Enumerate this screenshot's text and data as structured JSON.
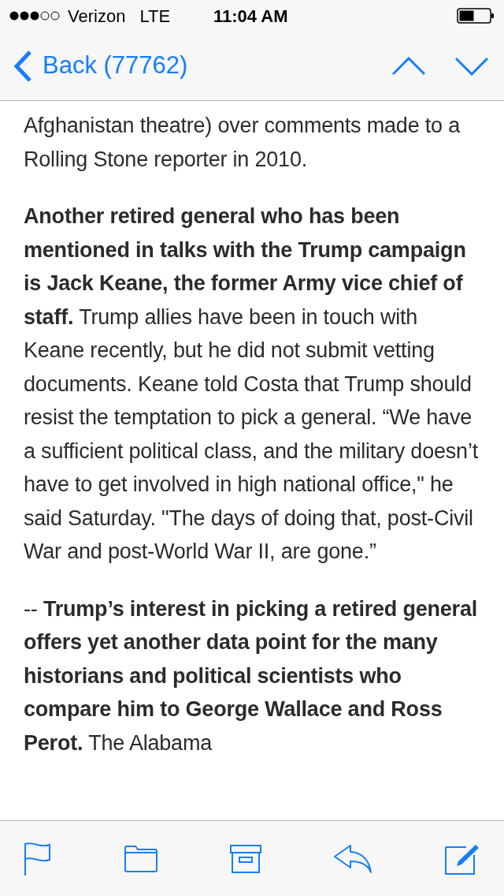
{
  "status_bar": {
    "carrier": "Verizon",
    "network": "LTE",
    "time": "11:04 AM"
  },
  "nav_bar": {
    "back": "Back (77762)"
  },
  "message": {
    "paragraphs": [
      "Afghanistan theatre) over comments made to a Rolling Stone reporter in 2010.",
      "**Another retired general who has been mentioned in talks with the Trump campaign is Jack Keane, the former Army vice chief of staff.** Trump allies have been in touch with Keane recently, but he did not submit vetting documents. Keane told Costa that Trump should resist the temptation to pick a general. “We have a sufficient political class, and the military doesn’t have to get involved in high national office,\" he said Saturday. \"The days of doing that, post-Civil War and post-World War II, are gone.”",
      "-- **Trump’s interest in picking a retired general offers yet another data point for the many historians and political scientists who compare him to George Wallace and Ross Perot.** The Alabama"
    ]
  }
}
